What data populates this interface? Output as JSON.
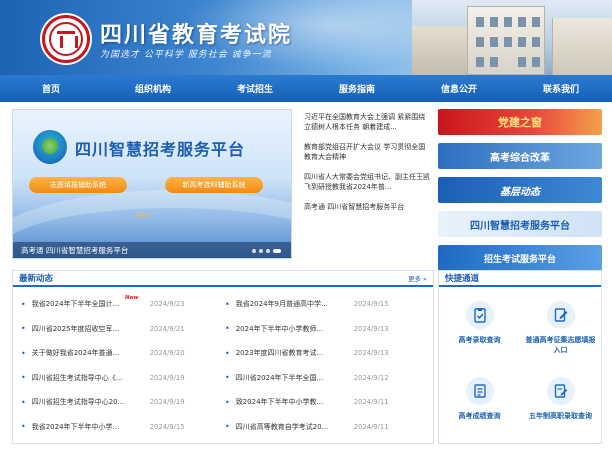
{
  "header": {
    "title": "四川省教育考试院",
    "motto": "为国选才  公平科学  服务社会  诚争一流"
  },
  "nav": [
    "首页",
    "组织机构",
    "考试招生",
    "服务指南",
    "信息公开",
    "联系我们"
  ],
  "banner": {
    "title": "四川智慧招考服务平台",
    "button_left": "志愿填报辅助系统",
    "button_right": "新高考选科辅助系统",
    "caption": "高考通 四川省智慧招考服务平台"
  },
  "headlines": [
    "习近平在全国教育大会上强调 紧紧围绕立德树人根本任务 朝着建成...",
    "教育部党组召开扩大会议 学习贯彻全国教育大会精神",
    "四川省人大常委会党组书记、副主任王凯飞到研授教我省2024年普...",
    "高考通 四川省智慧招考服务平台"
  ],
  "promos": [
    "党建之窗",
    "高考综合改革",
    "基层动态",
    "四川智慧招考服务平台",
    "招生考试服务平台"
  ],
  "news": {
    "title": "最新动态",
    "more": "更多 »",
    "new_badge": "New",
    "left": [
      {
        "title": "我省2024年下半年全国计...",
        "date": "2024/9/23"
      },
      {
        "title": "四川省2025年度招收空军...",
        "date": "2024/9/21"
      },
      {
        "title": "关于做好我省2024年普通...",
        "date": "2024/9/20"
      },
      {
        "title": "四川省招生考试指导中心《...",
        "date": "2024/9/19"
      },
      {
        "title": "四川省招生考试指导中心20...",
        "date": "2024/9/19"
      },
      {
        "title": "我省2024年下半年中小学...",
        "date": "2024/9/15"
      }
    ],
    "right": [
      {
        "title": "我省2024年9月普通高中学...",
        "date": "2024/9/15"
      },
      {
        "title": "2024年下半年中小学教师...",
        "date": "2024/9/13"
      },
      {
        "title": "2023年度四川省教育考试...",
        "date": "2024/9/13"
      },
      {
        "title": "四川省2024年下半年全国...",
        "date": "2024/9/12"
      },
      {
        "title": "致2024年下半年中小学教...",
        "date": "2024/9/11"
      },
      {
        "title": "四川省高等教育自学考试20...",
        "date": "2024/9/11"
      }
    ]
  },
  "quick": {
    "title": "快捷通道",
    "items": [
      "高考录取查询",
      "普通高考征集志愿填报入口",
      "高考成绩查询",
      "五年制高职录取查询"
    ]
  }
}
